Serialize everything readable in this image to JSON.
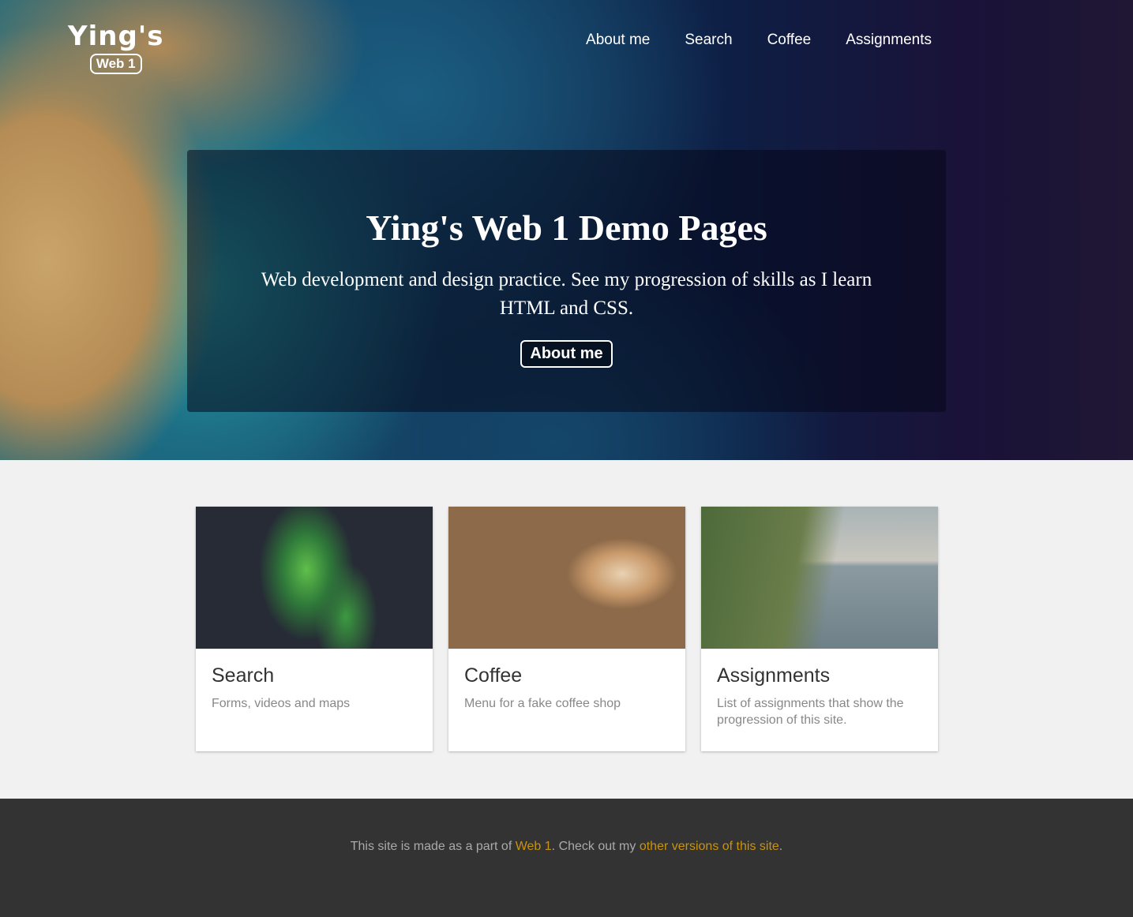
{
  "logo": {
    "title": "Ying's",
    "badge": "Web 1"
  },
  "nav": [
    {
      "label": "About me"
    },
    {
      "label": "Search"
    },
    {
      "label": "Coffee"
    },
    {
      "label": "Assignments"
    }
  ],
  "hero": {
    "title": "Ying's Web 1 Demo Pages",
    "subtitle": "Web development and design practice. See my progression of skills as I learn HTML and CSS.",
    "button": "About me"
  },
  "cards": [
    {
      "title": "Search",
      "description": "Forms, videos and maps"
    },
    {
      "title": "Coffee",
      "description": "Menu for a fake coffee shop"
    },
    {
      "title": "Assignments",
      "description": "List of assignments that show the progression of this site."
    }
  ],
  "footer": {
    "text1": "This site is made as a part of ",
    "link1": "Web 1",
    "text2": ". Check out my ",
    "link2": "other versions of this site",
    "text3": "."
  }
}
